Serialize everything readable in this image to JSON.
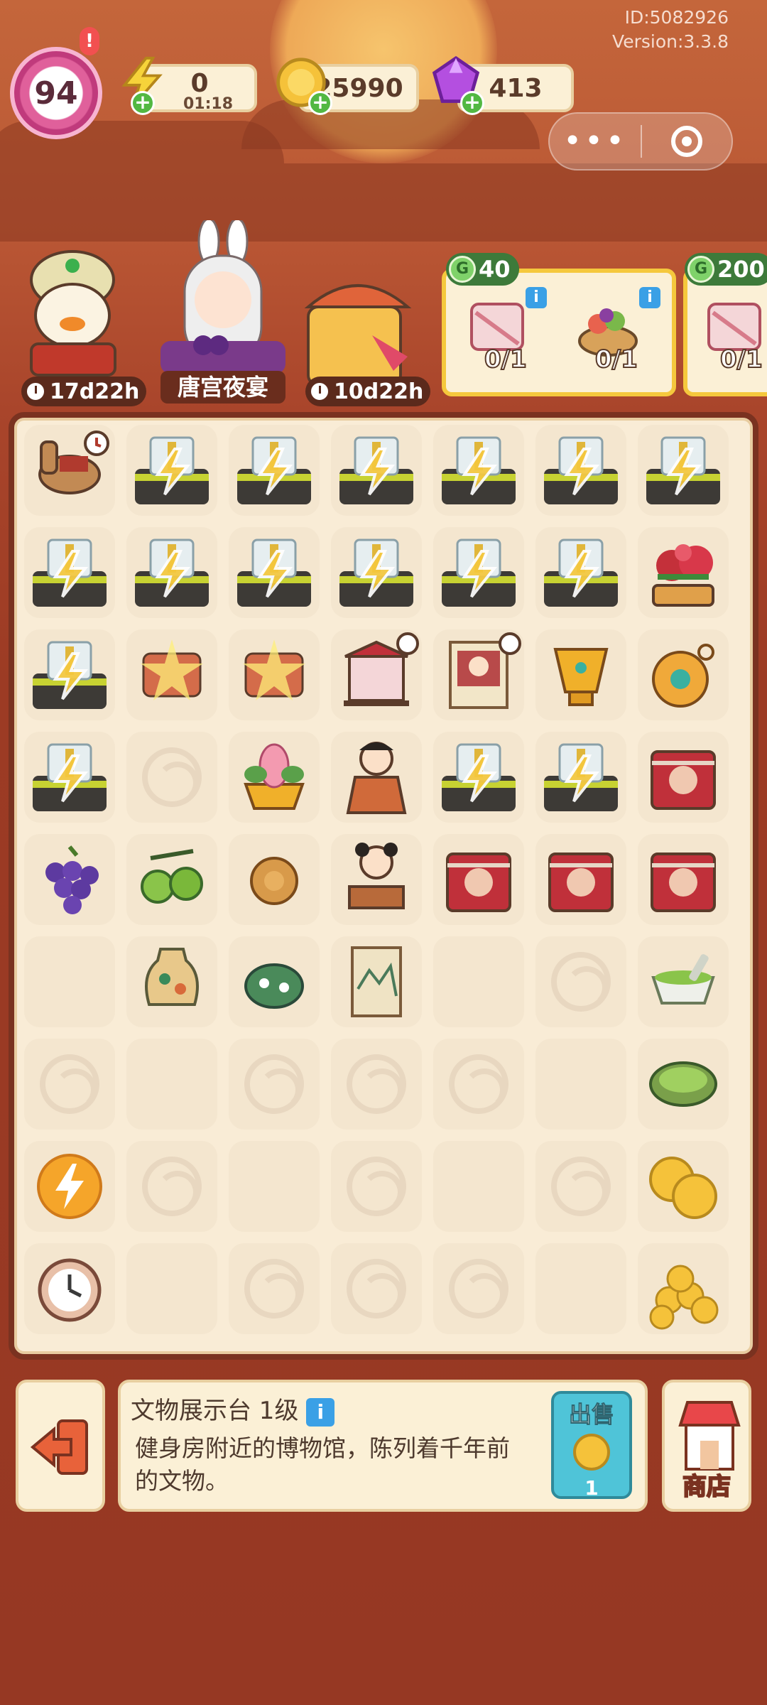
{
  "header": {
    "player_id": "ID:5082926",
    "version": "Version:3.3.8",
    "level": "94",
    "alert": "!",
    "energy": {
      "value": "0",
      "timer": "01:18",
      "icon": "lightning-icon"
    },
    "coins": {
      "value": "25990",
      "icon": "coin-icon"
    },
    "gems": {
      "value": "413",
      "icon": "gem-icon"
    },
    "menu": {
      "more": "•••",
      "close_icon": "target-icon"
    }
  },
  "characters": [
    {
      "name": "duck-merchant",
      "timer": "17d22h"
    },
    {
      "name": "rabbit-girl",
      "label": "唐宫夜宴"
    },
    {
      "name": "parasol-event",
      "timer": "10d22h"
    }
  ],
  "orders": [
    {
      "reward": "40",
      "items": [
        {
          "name": "embroidered-cloth",
          "count": "0/1"
        },
        {
          "name": "fruit-basket",
          "count": "0/1"
        }
      ]
    },
    {
      "reward": "200",
      "items": [
        {
          "name": "embroidered-cloth",
          "count": "0/1"
        }
      ]
    }
  ],
  "info_panel": {
    "title": "文物展示台 1级",
    "description": "健身房附近的博物馆，陈列着千年前的文物。",
    "sell_label": "出售",
    "sell_price": "1"
  },
  "shop": {
    "label": "商店"
  },
  "colors": {
    "accent": "#f5c83d",
    "board": "#f9ecd6",
    "frame": "#7a3220",
    "bg": "#9c3b24"
  }
}
